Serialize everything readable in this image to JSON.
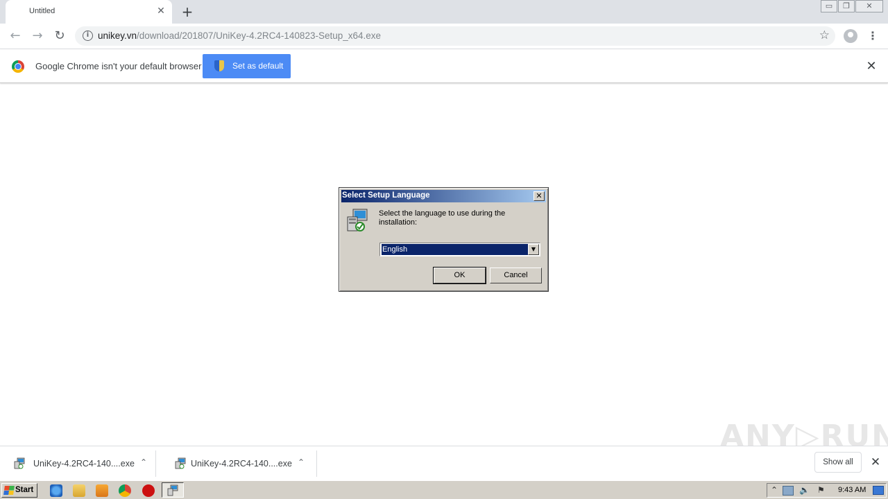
{
  "tab": {
    "title": "Untitled",
    "close_glyph": "✕",
    "new_tab_glyph": "+"
  },
  "window_controls": {
    "minimize": "▭",
    "restore": "❐",
    "close": "✕"
  },
  "toolbar": {
    "back_glyph": "←",
    "forward_glyph": "→",
    "reload_glyph": "↻",
    "url_host": "unikey.vn",
    "url_path": "/download/201807/UniKey-4.2RC4-140823-Setup_x64.exe",
    "info_glyph": "i",
    "star_glyph": "☆",
    "menu_glyph": "⋮"
  },
  "infobar": {
    "message": "Google Chrome isn't your default browser",
    "button_label": "Set as default",
    "close_glyph": "✕",
    "button_color": "#4c8bf5"
  },
  "dialog": {
    "title": "Select Setup Language",
    "close_glyph": "✕",
    "message": "Select the language to use during the installation:",
    "selected_language": "English",
    "arrow_glyph": "▼",
    "ok_label": "OK",
    "cancel_label": "Cancel",
    "title_color": "#0a246a"
  },
  "downloads": {
    "items": [
      {
        "name": "UniKey-4.2RC4-140....exe",
        "chevron": "⌃"
      },
      {
        "name": "UniKey-4.2RC4-140....exe",
        "chevron": "⌃"
      }
    ],
    "show_all_label": "Show all",
    "close_glyph": "✕"
  },
  "watermark": "ANY▷RUN",
  "taskbar": {
    "start_label": "Start",
    "clock": "9:43 AM",
    "tray_up_glyph": "⌃",
    "tray_speaker_glyph": "🔈",
    "tray_flag_glyph": "⚑"
  },
  "icons": {
    "tab_close": "close-icon",
    "new_tab": "plus-icon",
    "back": "arrow-left-icon",
    "forward": "arrow-right-icon",
    "reload": "reload-icon",
    "site_info": "info-icon",
    "bookmark": "star-icon",
    "profile": "avatar-icon",
    "menu": "kebab-menu-icon",
    "chrome": "chrome-logo-icon",
    "uac_shield": "shield-icon",
    "setup": "installer-icon"
  }
}
